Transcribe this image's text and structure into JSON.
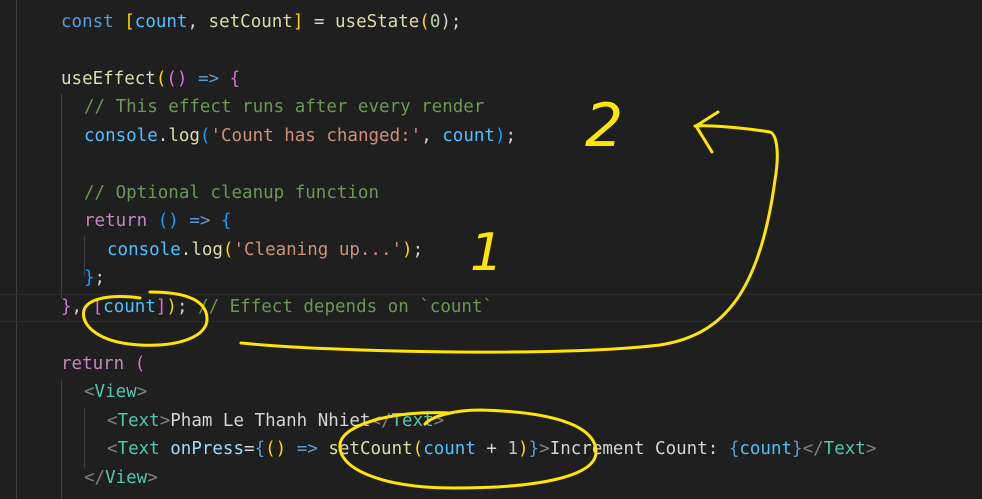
{
  "code": {
    "lines": [
      {
        "indent": "  ",
        "tokens": [
          {
            "t": "const",
            "c": "kw"
          },
          {
            "t": " ",
            "c": "pl"
          },
          {
            "t": "[",
            "c": "p1"
          },
          {
            "t": "count",
            "c": "var"
          },
          {
            "t": ", ",
            "c": "pl"
          },
          {
            "t": "setCount",
            "c": "fn"
          },
          {
            "t": "]",
            "c": "p1"
          },
          {
            "t": " = ",
            "c": "pl"
          },
          {
            "t": "useState",
            "c": "fn"
          },
          {
            "t": "(",
            "c": "p1"
          },
          {
            "t": "0",
            "c": "num"
          },
          {
            "t": ");",
            "c": "pl"
          }
        ]
      },
      {
        "indent": "",
        "tokens": []
      },
      {
        "indent": "  ",
        "tokens": [
          {
            "t": "useEffect",
            "c": "fn"
          },
          {
            "t": "(",
            "c": "p1"
          },
          {
            "t": "()",
            "c": "p2"
          },
          {
            "t": " ",
            "c": "pl"
          },
          {
            "t": "=>",
            "c": "kw"
          },
          {
            "t": " ",
            "c": "pl"
          },
          {
            "t": "{",
            "c": "p2"
          }
        ]
      },
      {
        "indent": "    ",
        "tokens": [
          {
            "t": "// This effect runs after every render",
            "c": "cmt"
          }
        ]
      },
      {
        "indent": "    ",
        "tokens": [
          {
            "t": "console",
            "c": "var"
          },
          {
            "t": ".",
            "c": "pl"
          },
          {
            "t": "log",
            "c": "fn"
          },
          {
            "t": "(",
            "c": "p3"
          },
          {
            "t": "'Count has changed:'",
            "c": "str"
          },
          {
            "t": ", ",
            "c": "pl"
          },
          {
            "t": "count",
            "c": "var"
          },
          {
            "t": ")",
            "c": "p3"
          },
          {
            "t": ";",
            "c": "pl"
          }
        ]
      },
      {
        "indent": "",
        "tokens": []
      },
      {
        "indent": "    ",
        "tokens": [
          {
            "t": "// Optional cleanup function",
            "c": "cmt"
          }
        ]
      },
      {
        "indent": "    ",
        "tokens": [
          {
            "t": "return",
            "c": "ctrl"
          },
          {
            "t": " ",
            "c": "pl"
          },
          {
            "t": "()",
            "c": "p3"
          },
          {
            "t": " ",
            "c": "pl"
          },
          {
            "t": "=>",
            "c": "kw"
          },
          {
            "t": " ",
            "c": "pl"
          },
          {
            "t": "{",
            "c": "p3"
          }
        ]
      },
      {
        "indent": "      ",
        "tokens": [
          {
            "t": "console",
            "c": "var"
          },
          {
            "t": ".",
            "c": "pl"
          },
          {
            "t": "log",
            "c": "fn"
          },
          {
            "t": "(",
            "c": "p1"
          },
          {
            "t": "'Cleaning up...'",
            "c": "str"
          },
          {
            "t": ")",
            "c": "p1"
          },
          {
            "t": ";",
            "c": "pl"
          }
        ]
      },
      {
        "indent": "    ",
        "tokens": [
          {
            "t": "}",
            "c": "p3"
          },
          {
            "t": ";",
            "c": "pl"
          }
        ]
      },
      {
        "indent": "  ",
        "tokens": [
          {
            "t": "}",
            "c": "p2"
          },
          {
            "t": ", ",
            "c": "pl"
          },
          {
            "t": "[",
            "c": "p2"
          },
          {
            "t": "count",
            "c": "var"
          },
          {
            "t": "]",
            "c": "p2"
          },
          {
            "t": ")",
            "c": "p1"
          },
          {
            "t": ";",
            "c": "pl"
          },
          {
            "t": " // Effect depends on `count`",
            "c": "cmt"
          }
        ]
      },
      {
        "indent": "",
        "tokens": []
      },
      {
        "indent": "  ",
        "tokens": [
          {
            "t": "return",
            "c": "ctrl"
          },
          {
            "t": " ",
            "c": "pl"
          },
          {
            "t": "(",
            "c": "p2"
          }
        ]
      },
      {
        "indent": "    ",
        "tokens": [
          {
            "t": "<",
            "c": "bracket-gray"
          },
          {
            "t": "View",
            "c": "comp"
          },
          {
            "t": ">",
            "c": "bracket-gray"
          }
        ]
      },
      {
        "indent": "      ",
        "tokens": [
          {
            "t": "<",
            "c": "bracket-gray"
          },
          {
            "t": "Text",
            "c": "comp"
          },
          {
            "t": ">",
            "c": "bracket-gray"
          },
          {
            "t": "Pham Le Thanh Nhiet",
            "c": "pl"
          },
          {
            "t": "</",
            "c": "bracket-gray"
          },
          {
            "t": "Text",
            "c": "comp"
          },
          {
            "t": ">",
            "c": "bracket-gray"
          }
        ]
      },
      {
        "indent": "      ",
        "tokens": [
          {
            "t": "<",
            "c": "bracket-gray"
          },
          {
            "t": "Text",
            "c": "comp"
          },
          {
            "t": " ",
            "c": "pl"
          },
          {
            "t": "onPress",
            "c": "attr"
          },
          {
            "t": "=",
            "c": "pl"
          },
          {
            "t": "{",
            "c": "kw"
          },
          {
            "t": "()",
            "c": "p1"
          },
          {
            "t": " ",
            "c": "pl"
          },
          {
            "t": "=>",
            "c": "kw"
          },
          {
            "t": " ",
            "c": "pl"
          },
          {
            "t": "setCount",
            "c": "fn"
          },
          {
            "t": "(",
            "c": "p1"
          },
          {
            "t": "count",
            "c": "var"
          },
          {
            "t": " + ",
            "c": "pl"
          },
          {
            "t": "1",
            "c": "num"
          },
          {
            "t": ")",
            "c": "p1"
          },
          {
            "t": "}",
            "c": "kw"
          },
          {
            "t": ">",
            "c": "bracket-gray"
          },
          {
            "t": "Increment Count: ",
            "c": "pl"
          },
          {
            "t": "{",
            "c": "kw"
          },
          {
            "t": "count",
            "c": "var"
          },
          {
            "t": "}",
            "c": "kw"
          },
          {
            "t": "</",
            "c": "bracket-gray"
          },
          {
            "t": "Text",
            "c": "comp"
          },
          {
            "t": ">",
            "c": "bracket-gray"
          }
        ]
      },
      {
        "indent": "    ",
        "tokens": [
          {
            "t": "</",
            "c": "bracket-gray"
          },
          {
            "t": "View",
            "c": "comp"
          },
          {
            "t": ">",
            "c": "bracket-gray"
          }
        ]
      }
    ]
  },
  "annotations": {
    "label_1": "1",
    "label_2": "2",
    "ink_color": "#ffe600"
  }
}
